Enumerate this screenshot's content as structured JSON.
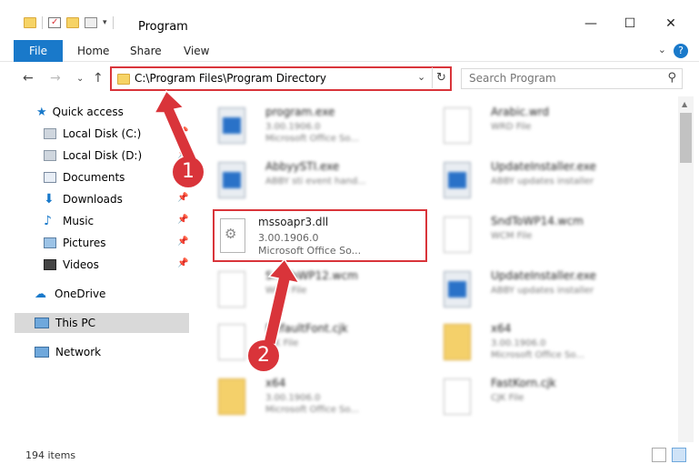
{
  "window": {
    "title": "Program",
    "controls": {
      "minimize": "—",
      "maximize": "☐",
      "close": "✕"
    }
  },
  "ribbon": {
    "tabs": [
      "File",
      "Home",
      "Share",
      "View"
    ],
    "help": "?"
  },
  "address_bar": {
    "path": "C:\\Program Files\\Program Directory",
    "search_placeholder": "Search Program"
  },
  "sidebar": {
    "items": [
      {
        "label": "Quick access",
        "icon": "star-icon",
        "pinned": false
      },
      {
        "label": "Local Disk (C:)",
        "icon": "drive-icon",
        "pinned": true
      },
      {
        "label": "Local Disk (D:)",
        "icon": "drive-icon",
        "pinned": true
      },
      {
        "label": "Documents",
        "icon": "documents-icon",
        "pinned": true
      },
      {
        "label": "Downloads",
        "icon": "download-icon",
        "pinned": true
      },
      {
        "label": "Music",
        "icon": "music-icon",
        "pinned": true
      },
      {
        "label": "Pictures",
        "icon": "pictures-icon",
        "pinned": true
      },
      {
        "label": "Videos",
        "icon": "videos-icon",
        "pinned": true
      },
      {
        "label": "OneDrive",
        "icon": "cloud-icon",
        "pinned": false
      },
      {
        "label": "This PC",
        "icon": "computer-icon",
        "pinned": false,
        "selected": true
      },
      {
        "label": "Network",
        "icon": "network-icon",
        "pinned": false
      }
    ]
  },
  "files": [
    {
      "name": "program.exe",
      "line2": "3.00.1906.0",
      "line3": "Microsoft Office So...",
      "type": "exe"
    },
    {
      "name": "Arabic.wrd",
      "line2": "WRD File",
      "line3": "",
      "type": "doc"
    },
    {
      "name": "AbbyySTI.exe",
      "line2": "ABBY sti event hand...",
      "line3": "",
      "type": "exe"
    },
    {
      "name": "UpdateInstaller.exe",
      "line2": "ABBY updates installer",
      "line3": "",
      "type": "exe"
    },
    {
      "name": "",
      "line2": "",
      "line3": "",
      "type": "blank"
    },
    {
      "name": "SndToWP14.wcm",
      "line2": "WCM File",
      "line3": "",
      "type": "doc"
    },
    {
      "name": "SndToWP12.wcm",
      "line2": "WCM File",
      "line3": "",
      "type": "doc"
    },
    {
      "name": "UpdateInstaller.exe",
      "line2": "ABBY updates installer",
      "line3": "",
      "type": "exe"
    },
    {
      "name": "DefaultFont.cjk",
      "line2": "CJK File",
      "line3": "",
      "type": "doc"
    },
    {
      "name": "x64",
      "line2": "3.00.1906.0",
      "line3": "Microsoft Office So...",
      "type": "folder"
    },
    {
      "name": "x64",
      "line2": "3.00.1906.0",
      "line3": "Microsoft Office So...",
      "type": "folder"
    },
    {
      "name": "FastKorn.cjk",
      "line2": "CJK File",
      "line3": "",
      "type": "doc"
    }
  ],
  "highlighted_file": {
    "name": "mssoapr3.dll",
    "version": "3.00.1906.0",
    "description": "Microsoft Office So..."
  },
  "status_bar": {
    "item_count": "194 items"
  },
  "callouts": [
    "1",
    "2"
  ],
  "colors": {
    "accent": "#1979ca",
    "highlight_red": "#d9343a",
    "selected_bg": "#d9d9d9"
  }
}
